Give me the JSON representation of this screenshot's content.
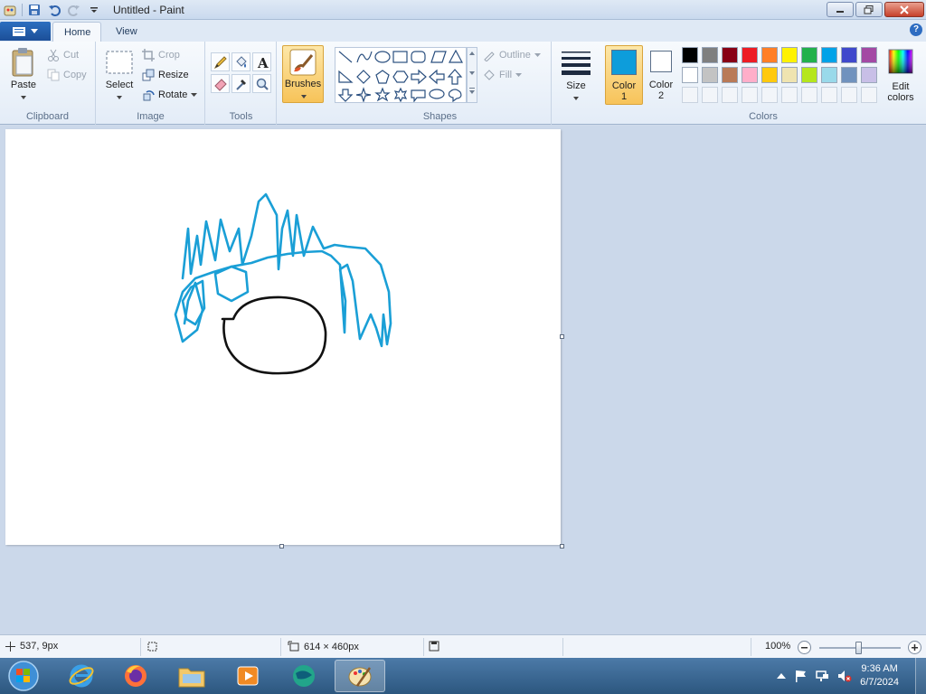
{
  "window": {
    "title": "Untitled - Paint"
  },
  "tabs": {
    "home": "Home",
    "view": "View"
  },
  "clipboard": {
    "paste": "Paste",
    "cut": "Cut",
    "copy": "Copy",
    "group_label": "Clipboard"
  },
  "image": {
    "select": "Select",
    "crop": "Crop",
    "resize": "Resize",
    "rotate": "Rotate",
    "group_label": "Image"
  },
  "tools": {
    "group_label": "Tools"
  },
  "brushes": {
    "label": "Brushes"
  },
  "shapes": {
    "outline": "Outline",
    "fill": "Fill",
    "group_label": "Shapes"
  },
  "size": {
    "label": "Size"
  },
  "colors": {
    "color1_line1": "Color",
    "color1_line2": "1",
    "color2_line1": "Color",
    "color2_line2": "2",
    "edit_line1": "Edit",
    "edit_line2": "colors",
    "group_label": "Colors",
    "color1_value": "#0d9ddb",
    "color2_value": "#ffffff",
    "palette_row1": [
      "#000000",
      "#7f7f7f",
      "#880015",
      "#ed1c24",
      "#ff7f27",
      "#fff200",
      "#22b14c",
      "#00a2e8",
      "#3f48cc",
      "#a349a4"
    ],
    "palette_row2": [
      "#ffffff",
      "#c3c3c3",
      "#b97a57",
      "#ffaec9",
      "#ffc90e",
      "#efe4b0",
      "#b5e61d",
      "#99d9ea",
      "#7092be",
      "#c8bfe7"
    ]
  },
  "statusbar": {
    "cursor_pos": "537, 9px",
    "canvas_size": "614 × 460px",
    "zoom": "100%"
  },
  "taskbar": {
    "time": "9:36 AM",
    "date": "6/7/2024"
  }
}
